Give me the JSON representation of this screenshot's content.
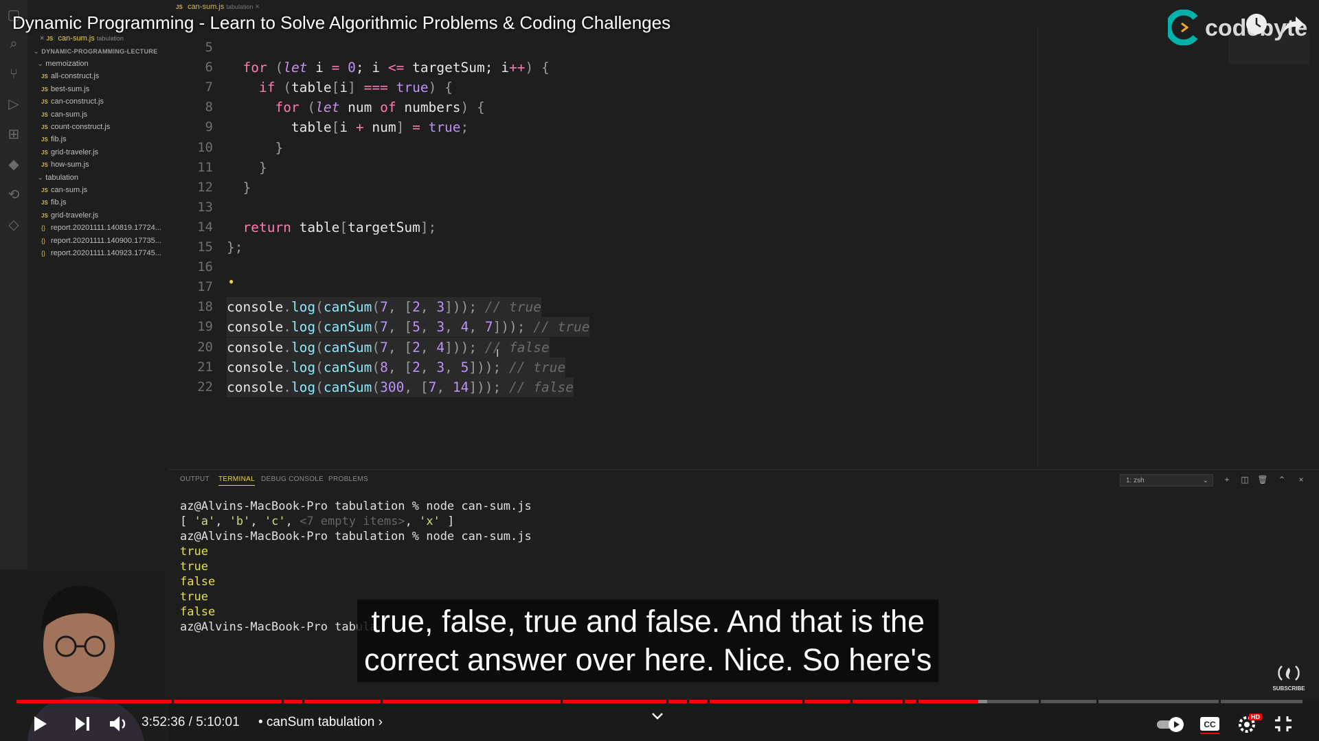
{
  "video": {
    "title": "Dynamic Programming - Learn to Solve Algorithmic Problems & Coding Challenges",
    "brand": "codebyte",
    "time_current": "3:52:36",
    "time_total": "5:10:01",
    "time_separator": " / ",
    "chapter": "• canSum tabulation ›",
    "subtitle_line1": "true, false, true and false. And that is the",
    "subtitle_line2": "correct answer over here. Nice. So here's",
    "progress": 0.748,
    "buffered": 0.755,
    "subscribe_label": "SUBSCRIBE",
    "hd_badge": "HD",
    "colors": {
      "progress": "#ff0000",
      "brand": "#00b2a9"
    }
  },
  "sidebar": {
    "open_editor": {
      "name": "can-sum.js",
      "folder": "tabulation"
    },
    "project": "DYNAMIC-PROGRAMMING-LECTURE",
    "folders": [
      {
        "name": "memoization",
        "files": [
          "all-construct.js",
          "best-sum.js",
          "can-construct.js",
          "can-sum.js",
          "count-construct.js",
          "fib.js",
          "grid-traveler.js",
          "how-sum.js"
        ]
      },
      {
        "name": "tabulation",
        "files": [
          "can-sum.js",
          "fib.js",
          "grid-traveler.js"
        ]
      }
    ],
    "reports": [
      "report.20201111.140819.17724...",
      "report.20201111.140900.17735...",
      "report.20201111.140923.17745..."
    ]
  },
  "editor": {
    "tab": {
      "name": "can-sum.js",
      "folder": "tabulation"
    },
    "lines": [
      {
        "n": "5",
        "tokens": []
      },
      {
        "n": "6",
        "tokens": [
          [
            "  ",
            "var"
          ],
          [
            "for",
            "kw"
          ],
          [
            " (",
            "punct"
          ],
          [
            "let",
            "it"
          ],
          [
            " i ",
            "var"
          ],
          [
            "=",
            "kw"
          ],
          [
            " ",
            "var"
          ],
          [
            "0",
            "num"
          ],
          [
            "; i ",
            "var"
          ],
          [
            "<=",
            "kw"
          ],
          [
            " targetSum; i",
            "var"
          ],
          [
            "++",
            "kw"
          ],
          [
            ") {",
            "punct"
          ]
        ]
      },
      {
        "n": "7",
        "tokens": [
          [
            "    ",
            "var"
          ],
          [
            "if",
            "kw"
          ],
          [
            " (",
            "punct"
          ],
          [
            "table",
            "var"
          ],
          [
            "[",
            "punct"
          ],
          [
            "i",
            "var"
          ],
          [
            "]",
            "punct"
          ],
          [
            " ",
            "var"
          ],
          [
            "===",
            "kw"
          ],
          [
            " ",
            "var"
          ],
          [
            "true",
            "bool"
          ],
          [
            ") {",
            "punct"
          ]
        ]
      },
      {
        "n": "8",
        "tokens": [
          [
            "      ",
            "var"
          ],
          [
            "for",
            "kw"
          ],
          [
            " (",
            "punct"
          ],
          [
            "let",
            "it"
          ],
          [
            " num ",
            "var"
          ],
          [
            "of",
            "kw"
          ],
          [
            " numbers",
            "var"
          ],
          [
            ") {",
            "punct"
          ]
        ]
      },
      {
        "n": "9",
        "tokens": [
          [
            "        ",
            "var"
          ],
          [
            "table",
            "var"
          ],
          [
            "[",
            "punct"
          ],
          [
            "i ",
            "var"
          ],
          [
            "+",
            "kw"
          ],
          [
            " num",
            "var"
          ],
          [
            "]",
            "punct"
          ],
          [
            " ",
            "var"
          ],
          [
            "=",
            "kw"
          ],
          [
            " ",
            "var"
          ],
          [
            "true",
            "bool"
          ],
          [
            ";",
            "punct"
          ]
        ]
      },
      {
        "n": "10",
        "tokens": [
          [
            "      }",
            "punct"
          ]
        ]
      },
      {
        "n": "11",
        "tokens": [
          [
            "    }",
            "punct"
          ]
        ]
      },
      {
        "n": "12",
        "tokens": [
          [
            "  }",
            "punct"
          ]
        ]
      },
      {
        "n": "13",
        "tokens": []
      },
      {
        "n": "14",
        "tokens": [
          [
            "  ",
            "var"
          ],
          [
            "return",
            "kw"
          ],
          [
            " table",
            "var"
          ],
          [
            "[",
            "punct"
          ],
          [
            "targetSum",
            "var"
          ],
          [
            "];",
            "punct"
          ]
        ]
      },
      {
        "n": "15",
        "tokens": [
          [
            "};",
            "punct"
          ]
        ]
      },
      {
        "n": "16",
        "tokens": []
      },
      {
        "n": "17",
        "tokens": []
      },
      {
        "n": "18",
        "hl": true,
        "tokens": [
          [
            "console",
            "var"
          ],
          [
            ".",
            "punct"
          ],
          [
            "log",
            "fn"
          ],
          [
            "(",
            "punct"
          ],
          [
            "canSum",
            "fn"
          ],
          [
            "(",
            "punct"
          ],
          [
            "7",
            "num"
          ],
          [
            ", ",
            "punct"
          ],
          [
            "[",
            "punct"
          ],
          [
            "2",
            "num"
          ],
          [
            ", ",
            "punct"
          ],
          [
            "3",
            "num"
          ],
          [
            "]));",
            "punct"
          ],
          [
            " // true",
            "cmt"
          ]
        ]
      },
      {
        "n": "19",
        "hl": true,
        "tokens": [
          [
            "console",
            "var"
          ],
          [
            ".",
            "punct"
          ],
          [
            "log",
            "fn"
          ],
          [
            "(",
            "punct"
          ],
          [
            "canSum",
            "fn"
          ],
          [
            "(",
            "punct"
          ],
          [
            "7",
            "num"
          ],
          [
            ", ",
            "punct"
          ],
          [
            "[",
            "punct"
          ],
          [
            "5",
            "num"
          ],
          [
            ", ",
            "punct"
          ],
          [
            "3",
            "num"
          ],
          [
            ", ",
            "punct"
          ],
          [
            "4",
            "num"
          ],
          [
            ", ",
            "punct"
          ],
          [
            "7",
            "num"
          ],
          [
            "]));",
            "punct"
          ],
          [
            " // true",
            "cmt"
          ]
        ]
      },
      {
        "n": "20",
        "hl": true,
        "tokens": [
          [
            "console",
            "var"
          ],
          [
            ".",
            "punct"
          ],
          [
            "log",
            "fn"
          ],
          [
            "(",
            "punct"
          ],
          [
            "canSum",
            "fn"
          ],
          [
            "(",
            "punct"
          ],
          [
            "7",
            "num"
          ],
          [
            ", ",
            "punct"
          ],
          [
            "[",
            "punct"
          ],
          [
            "2",
            "num"
          ],
          [
            ", ",
            "punct"
          ],
          [
            "4",
            "num"
          ],
          [
            "]));",
            "punct"
          ],
          [
            " // false",
            "cmt"
          ]
        ]
      },
      {
        "n": "21",
        "hl": true,
        "tokens": [
          [
            "console",
            "var"
          ],
          [
            ".",
            "punct"
          ],
          [
            "log",
            "fn"
          ],
          [
            "(",
            "punct"
          ],
          [
            "canSum",
            "fn"
          ],
          [
            "(",
            "punct"
          ],
          [
            "8",
            "num"
          ],
          [
            ", ",
            "punct"
          ],
          [
            "[",
            "punct"
          ],
          [
            "2",
            "num"
          ],
          [
            ", ",
            "punct"
          ],
          [
            "3",
            "num"
          ],
          [
            ", ",
            "punct"
          ],
          [
            "5",
            "num"
          ],
          [
            "]));",
            "punct"
          ],
          [
            " // true",
            "cmt"
          ]
        ]
      },
      {
        "n": "22",
        "hl": true,
        "tokens": [
          [
            "console",
            "var"
          ],
          [
            ".",
            "punct"
          ],
          [
            "log",
            "fn"
          ],
          [
            "(",
            "punct"
          ],
          [
            "canSum",
            "fn"
          ],
          [
            "(",
            "punct"
          ],
          [
            "300",
            "num"
          ],
          [
            ", ",
            "punct"
          ],
          [
            "[",
            "punct"
          ],
          [
            "7",
            "num"
          ],
          [
            ", ",
            "punct"
          ],
          [
            "14",
            "num"
          ],
          [
            "]));",
            "punct"
          ],
          [
            " // false",
            "cmt"
          ]
        ]
      }
    ]
  },
  "panel": {
    "tabs": [
      "OUTPUT",
      "TERMINAL",
      "DEBUG CONSOLE",
      "PROBLEMS"
    ],
    "active_tab": "TERMINAL",
    "terminal_select": "1: zsh",
    "lines": [
      {
        "tokens": [
          [
            "az@Alvins-MacBook-Pro tabulation % node can-sum.js",
            "plain"
          ]
        ]
      },
      {
        "tokens": [
          [
            "[ ",
            "plain"
          ],
          [
            "'a'",
            "str"
          ],
          [
            ", ",
            "plain"
          ],
          [
            "'b'",
            "str"
          ],
          [
            ", ",
            "plain"
          ],
          [
            "'c'",
            "str"
          ],
          [
            ", ",
            "plain"
          ],
          [
            "<7 empty items>",
            "dim"
          ],
          [
            ", ",
            "plain"
          ],
          [
            "'x'",
            "str"
          ],
          [
            " ]",
            "plain"
          ]
        ]
      },
      {
        "tokens": [
          [
            "az@Alvins-MacBook-Pro tabulation % node can-sum.js",
            "plain"
          ]
        ]
      },
      {
        "tokens": [
          [
            "true",
            "yellow"
          ]
        ]
      },
      {
        "tokens": [
          [
            "true",
            "yellow"
          ]
        ]
      },
      {
        "tokens": [
          [
            "false",
            "yellow"
          ]
        ]
      },
      {
        "tokens": [
          [
            "true",
            "yellow"
          ]
        ]
      },
      {
        "tokens": [
          [
            "false",
            "yellow"
          ]
        ]
      },
      {
        "tokens": [
          [
            "az@Alvins-MacBook-Pro tabula",
            "plain"
          ]
        ]
      }
    ]
  }
}
